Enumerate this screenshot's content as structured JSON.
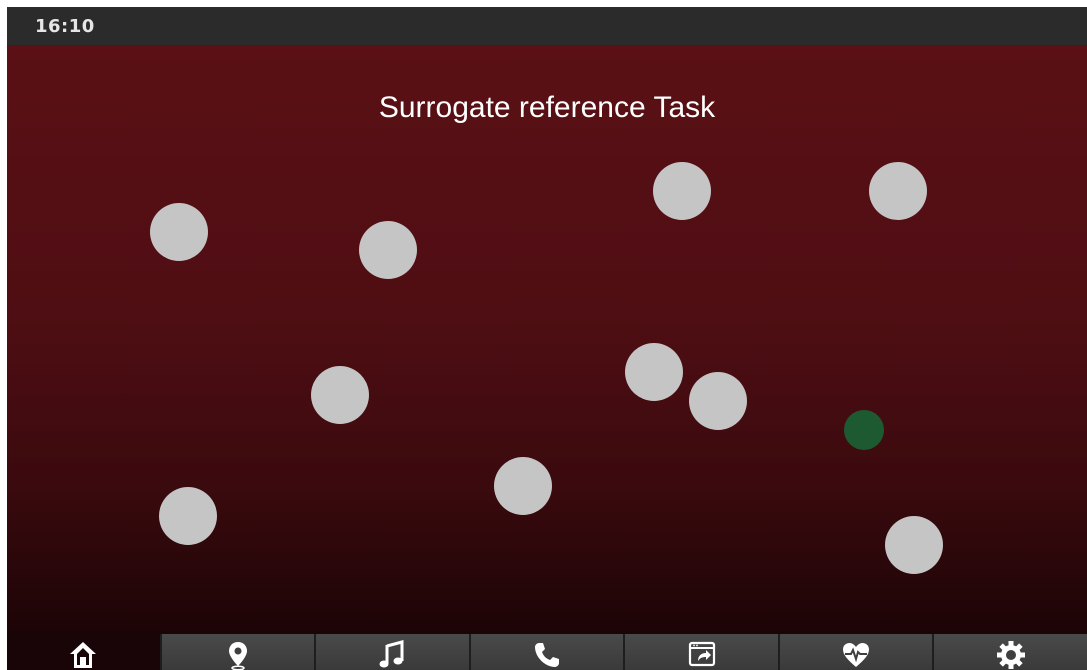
{
  "status_bar": {
    "time": "16:10"
  },
  "task": {
    "title": "Surrogate reference Task",
    "background_top": "#5a1015",
    "background_bottom": "#1c0406",
    "target_color": "#c5c5c5",
    "goal_color": "#1d5a32"
  },
  "targets": [
    {
      "id": "target-1",
      "kind": "distractor"
    },
    {
      "id": "target-2",
      "kind": "distractor"
    },
    {
      "id": "target-3",
      "kind": "distractor"
    },
    {
      "id": "target-4",
      "kind": "distractor"
    },
    {
      "id": "target-5",
      "kind": "distractor"
    },
    {
      "id": "target-6",
      "kind": "distractor"
    },
    {
      "id": "target-7",
      "kind": "distractor"
    },
    {
      "id": "target-8",
      "kind": "distractor"
    },
    {
      "id": "target-9",
      "kind": "distractor"
    },
    {
      "id": "target-10",
      "kind": "distractor"
    },
    {
      "id": "target-11",
      "kind": "goal"
    }
  ],
  "nav_bar": {
    "active": "home",
    "items": [
      {
        "id": "home",
        "icon": "home-icon"
      },
      {
        "id": "navigation",
        "icon": "location-pin-icon"
      },
      {
        "id": "music",
        "icon": "music-note-icon"
      },
      {
        "id": "phone",
        "icon": "phone-icon"
      },
      {
        "id": "screen-mirror",
        "icon": "screen-share-icon"
      },
      {
        "id": "health",
        "icon": "heart-pulse-icon"
      },
      {
        "id": "settings",
        "icon": "gear-icon"
      }
    ]
  }
}
